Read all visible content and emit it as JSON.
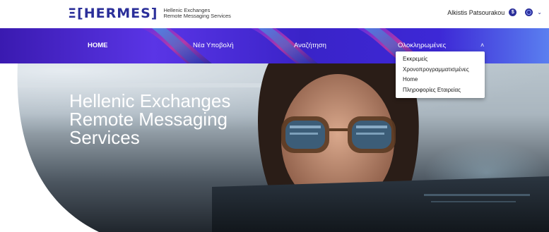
{
  "header": {
    "logo_text": "Ξ[HERMES]",
    "logo_sub_line1": "Hellenic Exchanges",
    "logo_sub_line2": "Remote Messaging Services",
    "user_name": "Alkistis Patsourakou",
    "user_badge": "$",
    "user_icon": "user-settings-icon",
    "language_icon": "globe-icon",
    "language_chevron": "⌄"
  },
  "nav": {
    "items": [
      {
        "label": "HOME"
      },
      {
        "label": "Νέα Υποβολή"
      },
      {
        "label": "Αναζήτηση"
      },
      {
        "label": "Ολοκληρωμένες"
      }
    ],
    "caret": "˄"
  },
  "dropdown": {
    "items": [
      {
        "label": "Εκκρεμείς"
      },
      {
        "label": "Χρονοπρογραμματισμένες"
      },
      {
        "label": "Home"
      },
      {
        "label": "Πληροφορίες Εταιρείας"
      }
    ]
  },
  "hero": {
    "title_line1": "Hellenic Exchanges",
    "title_line2": "Remote Messaging",
    "title_line3": "Services"
  },
  "colors": {
    "brand": "#2b2f9a",
    "nav_gradient_start": "#3a1ab0",
    "nav_gradient_end": "#5a7ff0"
  }
}
